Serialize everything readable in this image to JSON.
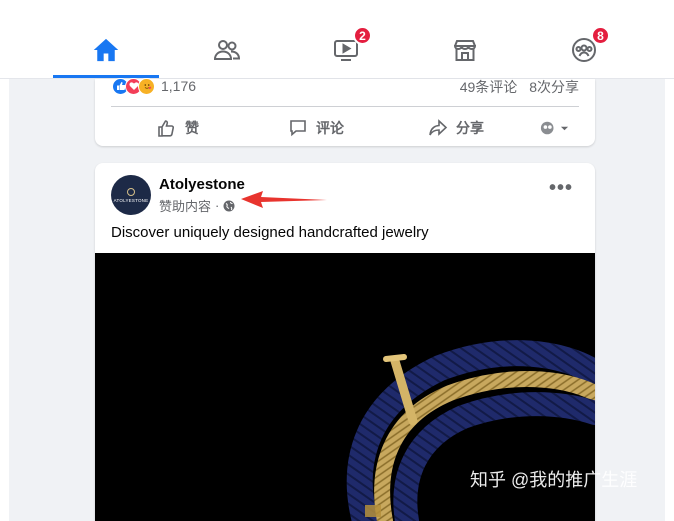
{
  "nav": {
    "items": [
      {
        "name": "home",
        "badge": null
      },
      {
        "name": "friends",
        "badge": null
      },
      {
        "name": "watch",
        "badge": "2"
      },
      {
        "name": "marketplace",
        "badge": null
      },
      {
        "name": "groups",
        "badge": "8"
      }
    ],
    "accent": "#1877f2"
  },
  "prev_post": {
    "reaction_count": "1,176",
    "comments": "49条评论",
    "shares": "8次分享",
    "actions": {
      "like": "赞",
      "comment": "评论",
      "share": "分享"
    }
  },
  "post": {
    "author": "Atolyestone",
    "avatar_text": "ATOLYESTONE",
    "sponsored": "赞助内容",
    "separator": "·",
    "more": "•••",
    "caption": "Discover uniquely designed handcrafted jewelry",
    "annotation_color": "#e8342e"
  },
  "watermark": "知乎 @我的推广生涯"
}
